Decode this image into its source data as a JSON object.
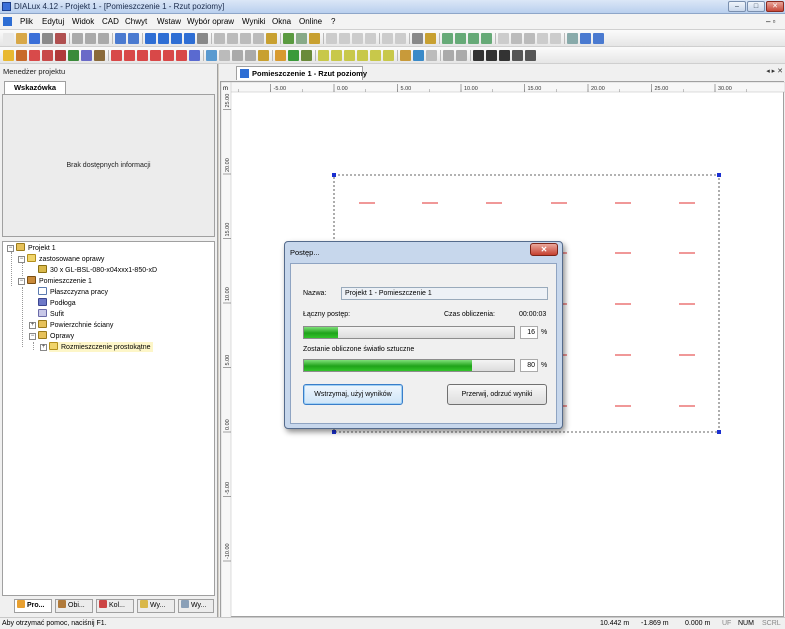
{
  "window": {
    "title": "DIALux 4.12 - Projekt 1 - [Pomieszczenie 1 - Rzut poziomy]",
    "controls": [
      "–",
      "□",
      "✕"
    ]
  },
  "menu": {
    "items": [
      "Plik",
      "Edytuj",
      "Widok",
      "CAD",
      "Chwyt",
      "Wstaw",
      "Wybór opraw",
      "Wyniki",
      "Okna",
      "Online",
      "?"
    ],
    "mdi_controls": "– ▫"
  },
  "left_panel": {
    "title": "Menedżer projektu",
    "tab": "Wskazówka",
    "hint_message": "Brak dostępnych informacji",
    "tree": {
      "project": "Projekt 1",
      "used_luminaires": "zastosowane oprawy",
      "luminaire": "30 x GL-BSL-080-x04xxx1-850-xD",
      "room": "Pomieszczenie 1",
      "work_plane": "Płaszczyzna pracy",
      "floor": "Podłoga",
      "ceiling": "Sufit",
      "wall_surfaces": "Powierzchnie ściany",
      "luminaires": "Oprawy",
      "layout": "Rozmieszczenie prostokątne"
    },
    "bottom_tabs": [
      "Pro...",
      "Obi...",
      "Kol...",
      "Wy...",
      "Wy..."
    ]
  },
  "document": {
    "tab": "Pomieszczenie 1 - Rzut poziomy",
    "nav": "◂ ▸ ✕",
    "ruler_unit": "m",
    "x_ticks": [
      "-5.00",
      "0.00",
      "5.00",
      "10.00",
      "15.00",
      "20.00",
      "25.00",
      "30.00"
    ],
    "y_ticks": [
      "25.00",
      "20.00",
      "15.00",
      "10.00",
      "5.00",
      "0.00",
      "-5.00",
      "-10.00"
    ]
  },
  "dialog": {
    "title": "Postęp...",
    "close": "✕",
    "name_label": "Nazwa:",
    "name_value": "Projekt 1 - Pomieszczenie 1",
    "total_progress_label": "Łączny postęp:",
    "calc_time_label": "Czas obliczenia:",
    "calc_time_value": "00:00:03",
    "total_progress_value": "16",
    "total_progress_fraction": 0.16,
    "percent_sign": "%",
    "task_label": "Zostanie obliczone światło sztuczne",
    "task_progress_value": "80",
    "task_progress_fraction": 0.8,
    "stop_use_button": "Wstrzymaj, użyj wyników",
    "abort_button": "Przerwij, odrzuć wyniki"
  },
  "status_bar": {
    "help": "Aby otrzymać pomoc, naciśnij F1.",
    "x_coord": "10.442 m",
    "y_coord": "-1.869 m",
    "z_coord": "0.000 m",
    "indicators": [
      "UF",
      "NUM",
      "SCRL"
    ]
  },
  "colors": {
    "progress_green": "#1fa31a",
    "luminaire_red": "#e03030",
    "room_outline": "#333333",
    "corner_blue": "#1a2fd0"
  }
}
